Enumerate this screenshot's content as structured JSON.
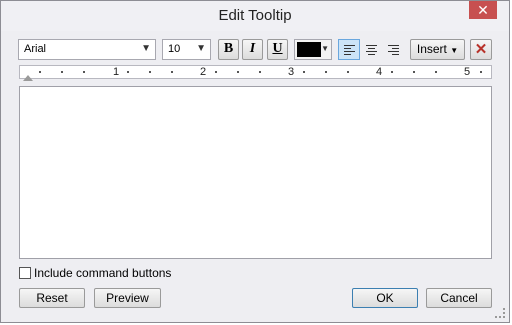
{
  "window": {
    "title": "Edit Tooltip",
    "close_symbol": "✕"
  },
  "toolbar": {
    "font_family": "Arial",
    "font_size": "10",
    "bold_label": "B",
    "italic_label": "I",
    "underline_label": "U",
    "text_color": "#000000",
    "insert_label": "Insert",
    "clear_symbol": "✕"
  },
  "ruler": {
    "labels": [
      "1",
      "2",
      "3",
      "4",
      "5"
    ]
  },
  "options": {
    "include_command_buttons": "Include command buttons",
    "include_command_buttons_checked": false
  },
  "buttons": {
    "reset": "Reset",
    "preview": "Preview",
    "ok": "OK",
    "cancel": "Cancel"
  },
  "colors": {
    "close_red": "#c75050",
    "active_align": "#cce4f7"
  }
}
